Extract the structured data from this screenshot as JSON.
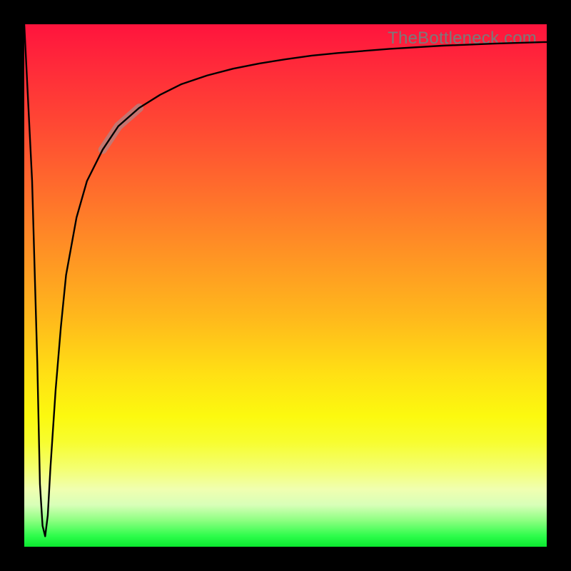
{
  "watermark": "TheBottleneck.com",
  "colors": {
    "frame": "#000000",
    "watermark": "#7a7a7a",
    "curve": "#000000",
    "highlight": "rgba(180,130,130,0.78)",
    "gradient_top": "#ff143d",
    "gradient_bottom": "#0be830"
  },
  "chart_data": {
    "type": "line",
    "title": "",
    "xlabel": "",
    "ylabel": "",
    "xlim": [
      0,
      100
    ],
    "ylim": [
      0,
      100
    ],
    "grid": false,
    "legend": false,
    "series": [
      {
        "name": "curve",
        "x": [
          0,
          1.5,
          2.5,
          3.0,
          3.5,
          4.0,
          4.5,
          5.0,
          6.0,
          7.0,
          8.0,
          10,
          12,
          15,
          18,
          22,
          26,
          30,
          35,
          40,
          45,
          50,
          55,
          60,
          70,
          80,
          90,
          100
        ],
        "y": [
          100,
          70,
          35,
          12,
          4,
          2,
          6,
          15,
          30,
          42,
          52,
          63,
          70,
          76,
          80.5,
          84,
          86.5,
          88.5,
          90.2,
          91.5,
          92.5,
          93.3,
          94.0,
          94.5,
          95.3,
          95.9,
          96.3,
          96.6
        ]
      }
    ],
    "annotations": [
      {
        "type": "segment_highlight",
        "x_range": [
          15,
          22
        ]
      }
    ]
  }
}
